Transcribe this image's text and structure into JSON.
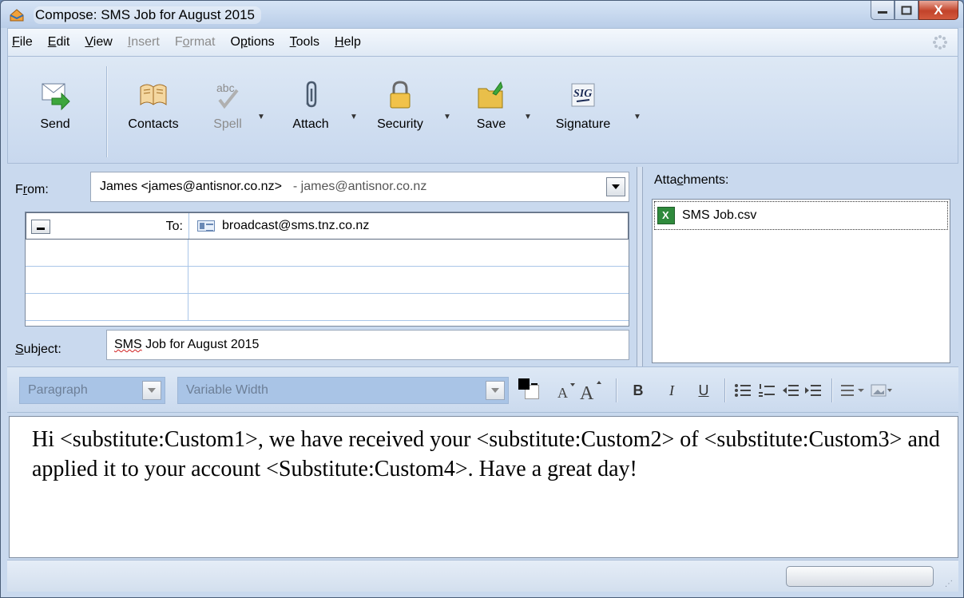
{
  "window": {
    "title": "Compose: SMS Job for August 2015",
    "buttons": {
      "minimize": "—",
      "maximize": "□",
      "close": "X"
    }
  },
  "menu": {
    "items": [
      {
        "label": "File",
        "accel": "F",
        "rest": "ile",
        "disabled": false
      },
      {
        "label": "Edit",
        "accel": "E",
        "rest": "dit",
        "disabled": false
      },
      {
        "label": "View",
        "accel": "V",
        "rest": "iew",
        "disabled": false
      },
      {
        "label": "Insert",
        "accel": "I",
        "rest": "nsert",
        "disabled": true
      },
      {
        "label": "Format",
        "pre": "F",
        "accel": "o",
        "rest": "rmat",
        "disabled": true
      },
      {
        "label": "Options",
        "pre": "O",
        "accel": "p",
        "rest": "tions",
        "disabled": false
      },
      {
        "label": "Tools",
        "accel": "T",
        "rest": "ools",
        "disabled": false
      },
      {
        "label": "Help",
        "accel": "H",
        "rest": "elp",
        "disabled": false
      }
    ]
  },
  "toolbar": {
    "send": "Send",
    "contacts": "Contacts",
    "spell": "Spell",
    "spell_icon_text": "abc",
    "attach": "Attach",
    "security": "Security",
    "save": "Save",
    "signature": "Signature",
    "signature_icon_text": "SIG"
  },
  "header": {
    "from_label_pre": "F",
    "from_label_accel": "r",
    "from_label_rest": "om:",
    "from_value": "James <james@antisnor.co.nz>",
    "from_extra": "- james@antisnor.co.nz",
    "to_label": "To:",
    "to_value": "broadcast@sms.tnz.co.nz",
    "subject_label_accel": "S",
    "subject_label_rest": "ubject:",
    "subject_value_err": "SMS",
    "subject_value_rest": " Job for August 2015"
  },
  "attachments": {
    "label_pre": "Atta",
    "label_accel": "c",
    "label_rest": "hments:",
    "files": [
      "SMS Job.csv"
    ]
  },
  "format": {
    "paragraph": "Paragraph",
    "font": "Variable Width",
    "bold": "B",
    "italic": "I",
    "underline": "U"
  },
  "body": {
    "text": "Hi <substitute:Custom1>, we have received your <substitute:Custom2> of <substitute:Custom3> and applied it to your account <Substitute:Custom4>. Have a great day!"
  },
  "colors": {
    "frame": "#c9d9ee",
    "accent": "#a9c4e6",
    "close_button": "#c2432a"
  }
}
